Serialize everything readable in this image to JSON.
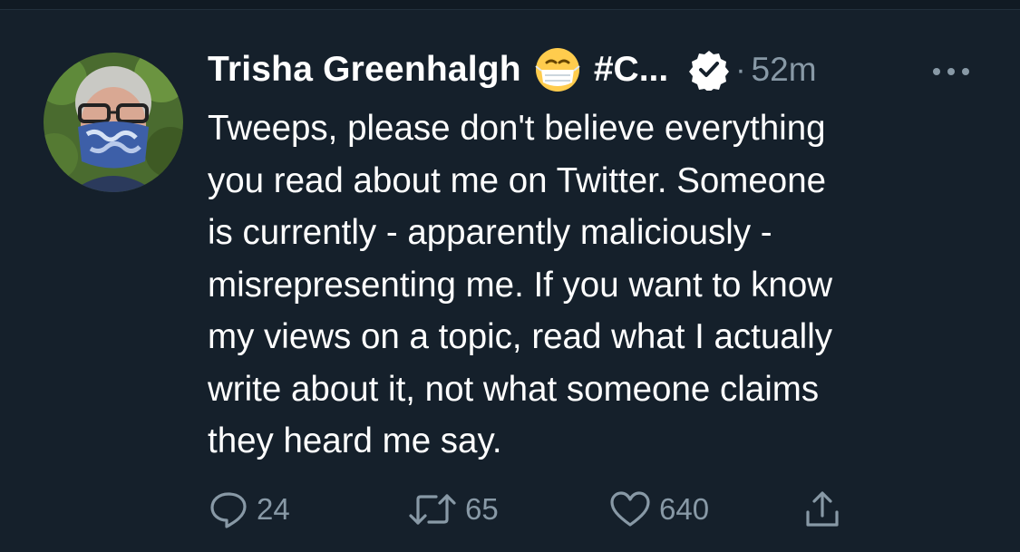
{
  "tweet": {
    "display_name": "Trisha Greenhalgh",
    "name_tag": "#C...",
    "emoji": "face-with-medical-mask",
    "verified": true,
    "separator": "·",
    "timestamp": "52m",
    "text_lines": [
      "Tweeps, please don't believe everything",
      "you read about me on Twitter. Someone",
      "is currently - apparently maliciously -",
      "misrepresenting me. If you want to know",
      "my views on a topic, read what I actually",
      "write about it, not what someone claims",
      "they heard me say."
    ],
    "actions": {
      "reply_count": "24",
      "retweet_count": "65",
      "like_count": "640"
    }
  },
  "colors": {
    "background": "#15202b",
    "text": "#ffffff",
    "secondary": "#8899a6"
  },
  "icons": [
    "more-icon",
    "reply-icon",
    "retweet-icon",
    "like-icon",
    "share-icon",
    "verified-badge-icon",
    "mask-emoji-icon"
  ]
}
